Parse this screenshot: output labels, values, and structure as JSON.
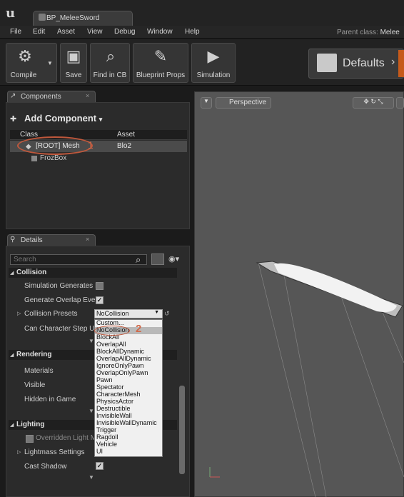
{
  "window": {
    "tab_title": "BP_MeleeSword"
  },
  "menu": [
    "File",
    "Edit",
    "Asset",
    "View",
    "Debug",
    "Window",
    "Help"
  ],
  "parent_class": {
    "label": "Parent class:",
    "value": "Melee"
  },
  "toolbar": {
    "compile": "Compile",
    "save": "Save",
    "find_in_cb": "Find in CB",
    "blueprint_props": "Blueprint Props",
    "simulation": "Simulation",
    "defaults": "Defaults"
  },
  "components": {
    "tab": "Components",
    "add_component": "Add Component",
    "columns": {
      "class": "Class",
      "asset": "Asset"
    },
    "rows": [
      {
        "name": "[ROOT] Mesh",
        "asset": "Blo2",
        "annotation": "1"
      },
      {
        "name": "FrozBox",
        "asset": ""
      }
    ]
  },
  "details": {
    "tab": "Details",
    "search_placeholder": "Search",
    "collision": {
      "header": "Collision",
      "simulation_generates": "Simulation Generates I",
      "generate_overlap": "Generate Overlap Even",
      "collision_presets": "Collision Presets",
      "preset_value": "NoCollision",
      "can_character_step": "Can Character Step Up"
    },
    "rendering": {
      "header": "Rendering",
      "materials": "Materials",
      "visible": "Visible",
      "hidden_in_game": "Hidden in Game"
    },
    "lighting": {
      "header": "Lighting",
      "override_light": "Overridden Light M",
      "lightmass_settings": "Lightmass Settings",
      "cast_shadow": "Cast Shadow"
    }
  },
  "dropdown": {
    "options": [
      "Custom...",
      "NoCollision",
      "BlockAll",
      "OverlapAll",
      "BlockAllDynamic",
      "OverlapAllDynamic",
      "IgnoreOnlyPawn",
      "OverlapOnlyPawn",
      "Pawn",
      "Spectator",
      "CharacterMesh",
      "PhysicsActor",
      "Destructible",
      "InvisibleWall",
      "InvisibleWallDynamic",
      "Trigger",
      "Ragdoll",
      "Vehicle",
      "UI"
    ],
    "selected": "NoCollision",
    "annotation": "2"
  },
  "viewport": {
    "perspective": "Perspective"
  },
  "colors": {
    "annotation": "#d06a4a",
    "accent_orange": "#c65a1a",
    "selection": "#4b4b4b"
  }
}
